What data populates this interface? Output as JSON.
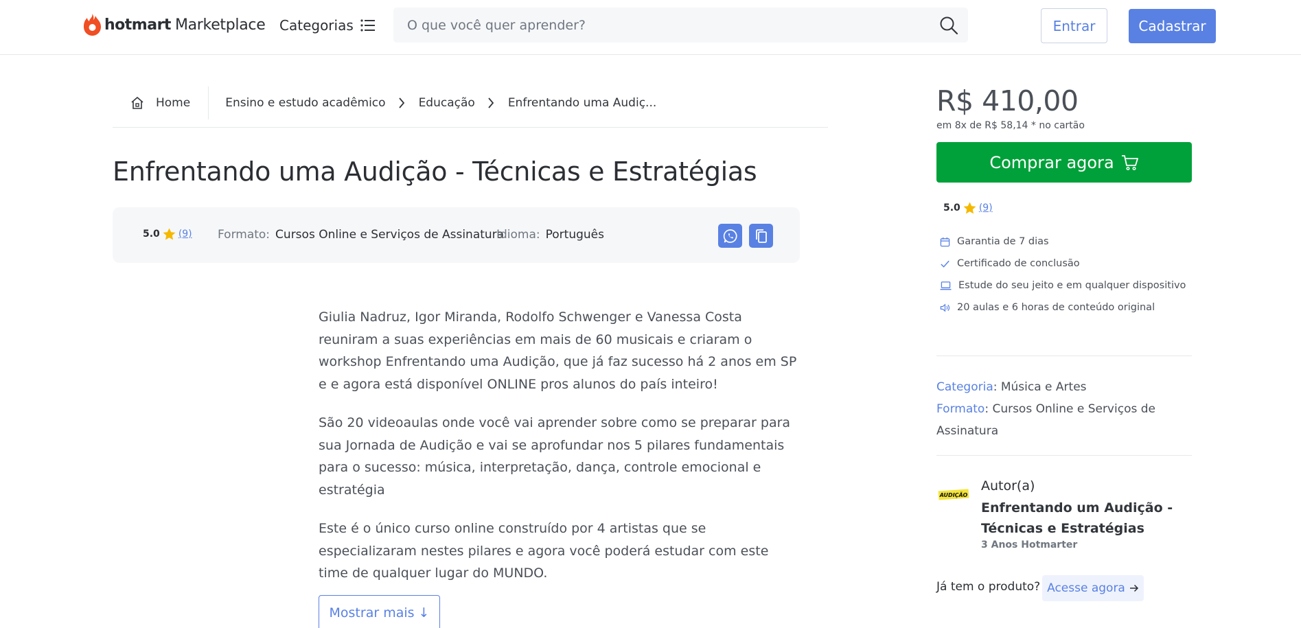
{
  "header": {
    "logo_brand": "hotmart",
    "logo_suffix": "Marketplace",
    "categories_label": "Categorias",
    "search_placeholder": "O que você quer aprender?",
    "login_label": "Entrar",
    "signup_label": "Cadastrar"
  },
  "breadcrumb": {
    "home": "Home",
    "items": [
      "Ensino e estudo acadêmico",
      "Educação",
      "Enfrentando uma Audiç..."
    ]
  },
  "product": {
    "title": "Enfrentando uma Audição - Técnicas e Estratégias",
    "rating": "5.0",
    "rating_count": "(9)",
    "format_label": "Formato:",
    "format_value": "Cursos Online e Serviços de Assinatura",
    "language_label": "Idioma:",
    "language_value": "Português"
  },
  "description": {
    "paragraphs": [
      "Giulia Nadruz, Igor Miranda, Rodolfo Schwenger e Vanessa Costa reuniram a suas experiências em mais de 60 musicais e criaram o workshop Enfrentando uma Audição, que já faz sucesso há 2 anos em SP e e agora está disponível ONLINE pros alunos do país inteiro!",
      "São 20 videoaulas onde você vai aprender sobre como se preparar para sua Jornada de Audição e vai se aprofundar nos 5 pilares fundamentais para o sucesso: música, interpretação, dança, controle emocional e estratégia",
      "Este é o único curso online construído por 4 artistas que se especializaram nestes pilares e agora você poderá estudar com este time de qualquer lugar do MUNDO."
    ],
    "show_more": "Mostrar mais ↓"
  },
  "purchase": {
    "price": "R$ 410,00",
    "installments": "em 8x de R$ 58,14 * no cartão",
    "buy_label": "Comprar agora",
    "rating": "5.0",
    "rating_count": "(9)",
    "features": [
      {
        "icon": "calendar-icon",
        "text": "Garantia de 7 dias"
      },
      {
        "icon": "check-icon",
        "text": "Certificado de conclusão"
      },
      {
        "icon": "laptop-icon",
        "text": "Estude do seu jeito e em qualquer dispositivo"
      },
      {
        "icon": "speaker-icon",
        "text": "20 aulas e 6 horas de conteúdo original"
      }
    ]
  },
  "meta": {
    "category_key": "Categoria",
    "category_value": ": Música e Artes",
    "format_key": "Formato",
    "format_value": ": Cursos Online e Serviços de Assinatura"
  },
  "author": {
    "logo_text": "AUDIÇÃO",
    "label": "Autor(a)",
    "name": "Enfrentando um Audição - Técnicas e Estratégias",
    "since": "3 Anos Hotmarter"
  },
  "access": {
    "question": "Já tem o produto?",
    "button": "Acesse agora"
  },
  "colors": {
    "brand_orange": "#f04e23",
    "accent_blue": "#5981e3",
    "buy_green": "#00a13a",
    "star_yellow": "#f5b800"
  }
}
